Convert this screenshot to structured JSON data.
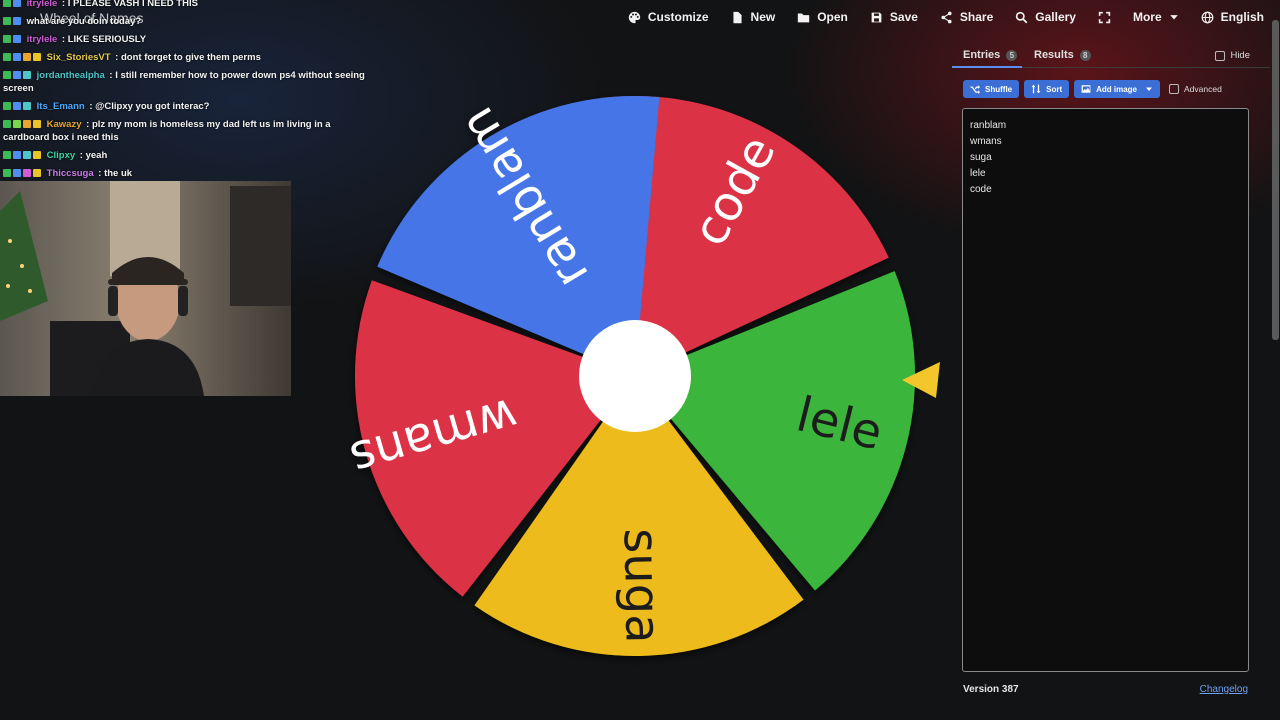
{
  "site_title": "Wheel of Names",
  "menu": [
    {
      "label": "Customize",
      "icon": "palette-icon"
    },
    {
      "label": "New",
      "icon": "file-icon"
    },
    {
      "label": "Open",
      "icon": "folder-icon"
    },
    {
      "label": "Save",
      "icon": "save-icon"
    },
    {
      "label": "Share",
      "icon": "share-icon"
    },
    {
      "label": "Gallery",
      "icon": "search-icon"
    },
    {
      "label": "",
      "icon": "fullscreen-icon"
    },
    {
      "label": "More",
      "icon": "chevron-down-icon"
    },
    {
      "label": "English",
      "icon": "globe-icon"
    }
  ],
  "chat": [
    {
      "user": "itrylele",
      "user_color": "#d45bd8",
      "message": "I PLEASE VASH I NEED THIS"
    },
    {
      "user": "",
      "user_color": "#9bd",
      "message": "what are you doin today?"
    },
    {
      "user": "itrylele",
      "user_color": "#d45bd8",
      "message": "LIKE SERIOUSLY"
    },
    {
      "user": "Six_StoriesVT",
      "user_color": "#e2c84a",
      "message": "dont forget to give them perms"
    },
    {
      "user": "jordanthealpha",
      "user_color": "#4fc5c8",
      "message": "I still remember how to power down ps4 without seeing screen"
    },
    {
      "user": "Its_Emann",
      "user_color": "#4fa8ff",
      "message": "@Clipxy you got interac?"
    },
    {
      "user": "Kawazy",
      "user_color": "#e6a72e",
      "message": "plz my mom is homeless my dad left us im living in a cardboard box i need this"
    },
    {
      "user": "Clipxy",
      "user_color": "#3fd2a2",
      "message": "yeah"
    },
    {
      "user": "Thiccsuga",
      "user_color": "#c97be8",
      "message": "the uk"
    }
  ],
  "wheel": {
    "segments": [
      {
        "label": "code",
        "color": "#db3045"
      },
      {
        "label": "lele",
        "color": "#3bb53b"
      },
      {
        "label": "suga",
        "color": "#edbc1f"
      },
      {
        "label": "wmans",
        "color": "#db3045"
      },
      {
        "label": "ranblam",
        "color": "#4574e6"
      }
    ],
    "pointer_color": "#f3c72c",
    "hub_color": "#ffffff"
  },
  "panel": {
    "tab_entries": "Entries",
    "tab_entries_count": "5",
    "tab_results": "Results",
    "tab_results_count": "8",
    "hide_label": "Hide",
    "shuffle_label": "Shuffle",
    "sort_label": "Sort",
    "add_image_label": "Add image",
    "advanced_label": "Advanced",
    "entries": [
      "ranblam",
      "wmans",
      "suga",
      "lele",
      "code"
    ],
    "version": "Version 387",
    "changelog": "Changelog"
  }
}
